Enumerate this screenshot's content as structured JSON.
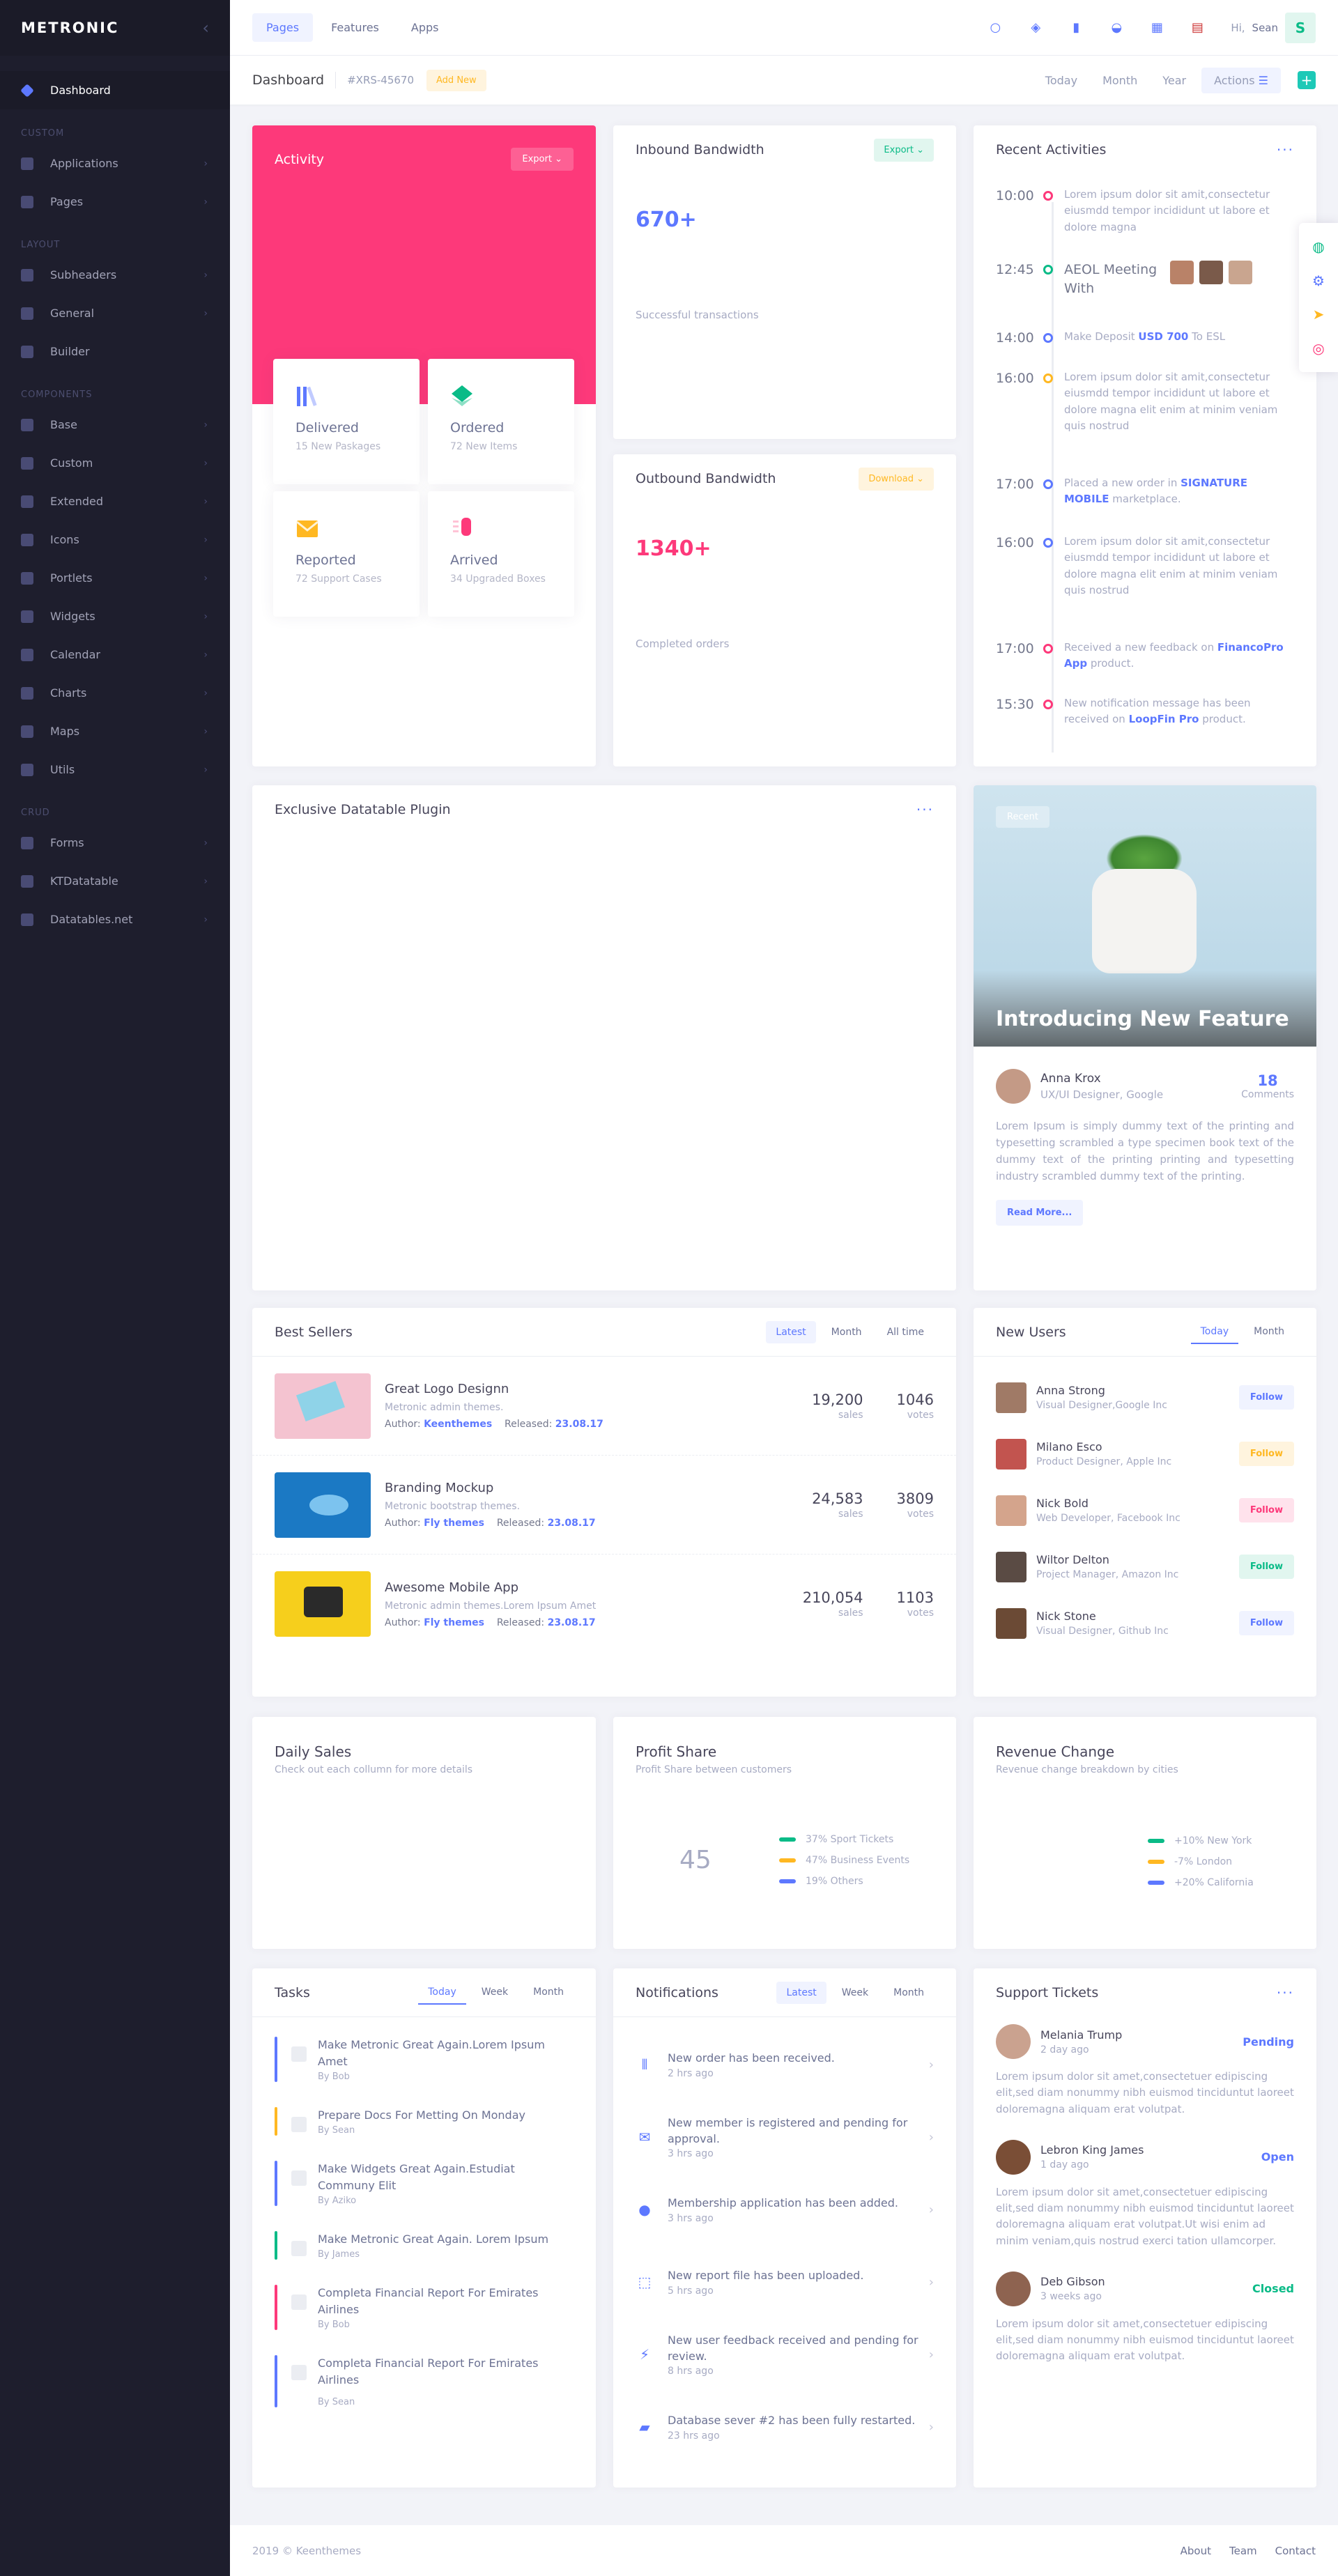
{
  "app": {
    "logo": "METRONIC",
    "collapse_icon": "chevron-left-icon"
  },
  "sidebar": {
    "dashboard": "Dashboard",
    "sections": {
      "custom": "CUSTOM",
      "layout": "LAYOUT",
      "components": "COMPONENTS",
      "crud": "CRUD"
    },
    "custom_items": [
      "Applications",
      "Pages"
    ],
    "layout_items": [
      "Subheaders",
      "General",
      "Builder"
    ],
    "component_items": [
      "Base",
      "Custom",
      "Extended",
      "Icons",
      "Portlets",
      "Widgets",
      "Calendar",
      "Charts",
      "Maps",
      "Utils"
    ],
    "crud_items": [
      "Forms",
      "KTDatatable",
      "Datatables.net"
    ]
  },
  "header": {
    "nav": [
      "Pages",
      "Features",
      "Apps"
    ],
    "greeting": "Hi,",
    "user_name": "Sean",
    "avatar_letter": "S"
  },
  "subheader": {
    "title": "Dashboard",
    "desc": "#XRS-45670",
    "add_new": "Add New",
    "ranges": [
      "Today",
      "Month",
      "Year"
    ],
    "actions": "Actions",
    "plus": "+"
  },
  "activity": {
    "title": "Activity",
    "export": "Export",
    "stats": [
      {
        "title": "Delivered",
        "sub": "15 New Paskages"
      },
      {
        "title": "Ordered",
        "sub": "72 New Items"
      },
      {
        "title": "Reported",
        "sub": "72 Support Cases"
      },
      {
        "title": "Arrived",
        "sub": "34 Upgraded Boxes"
      }
    ]
  },
  "inbound": {
    "title": "Inbound Bandwidth",
    "button": "Export",
    "value": "670+",
    "desc": "Successful transactions"
  },
  "outbound": {
    "title": "Outbound Bandwidth",
    "button": "Download",
    "value": "1340+",
    "desc": "Completed orders"
  },
  "recent_activities": {
    "title": "Recent Activities",
    "items": [
      {
        "time": "10:00",
        "text": "Lorem ipsum dolor sit amit,consectetur eiusmdd tempor incididunt ut labore et dolore magna",
        "color": "#fd397a"
      },
      {
        "time": "12:45",
        "text": "AEOL Meeting With",
        "color": "#0abb87"
      },
      {
        "time": "14:00",
        "pre": "Make Deposit",
        "link": "USD 700",
        "post": "To ESL",
        "color": "#5d78ff"
      },
      {
        "time": "16:00",
        "text": "Lorem ipsum dolor sit amit,consectetur eiusmdd tempor incididunt ut labore et dolore magna elit enim at minim veniam quis nostrud",
        "color": "#ffb822"
      },
      {
        "time": "17:00",
        "pre": "Placed a new order in",
        "link": "SIGNATURE MOBILE",
        "post": "marketplace.",
        "color": "#5d78ff"
      },
      {
        "time": "16:00",
        "text": "Lorem ipsum dolor sit amit,consectetur eiusmdd tempor incididunt ut labore et dolore magna elit enim at minim veniam quis nostrud",
        "color": "#5d78ff"
      },
      {
        "time": "17:00",
        "pre": "Received a new feedback on",
        "link": "FinancoPro App",
        "post": "product.",
        "color": "#fd397a"
      },
      {
        "time": "15:30",
        "pre": "New notification message has been received on",
        "link": "LoopFin Pro",
        "post": "product.",
        "color": "#fd397a"
      }
    ]
  },
  "datatable": {
    "title": "Exclusive Datatable Plugin"
  },
  "feature": {
    "badge": "Recent",
    "title": "Introducing New Feature",
    "author": "Anna Krox",
    "role": "UX/UI Designer, Google",
    "comments_count": "18",
    "comments_label": "Comments",
    "text": "Lorem Ipsum is simply dummy text of the printing and typesetting scrambled a type specimen book text of the dummy text of the printing printing and typesetting industry scrambled dummy text of the printing.",
    "read_more": "Read More..."
  },
  "best_sellers": {
    "title": "Best Sellers",
    "tabs": [
      "Latest",
      "Month",
      "All time"
    ],
    "items": [
      {
        "title": "Great Logo Designn",
        "desc": "Metronic admin themes.",
        "author_label": "Author:",
        "author": "Keenthemes",
        "released_label": "Released:",
        "released": "23.08.17",
        "sales": "19,200",
        "sales_label": "sales",
        "votes": "1046",
        "votes_label": "votes"
      },
      {
        "title": "Branding Mockup",
        "desc": "Metronic bootstrap themes.",
        "author_label": "Author:",
        "author": "Fly themes",
        "released_label": "Released:",
        "released": "23.08.17",
        "sales": "24,583",
        "sales_label": "sales",
        "votes": "3809",
        "votes_label": "votes"
      },
      {
        "title": "Awesome Mobile App",
        "desc": "Metronic admin themes.Lorem Ipsum Amet",
        "author_label": "Author:",
        "author": "Fly themes",
        "released_label": "Released:",
        "released": "23.08.17",
        "sales": "210,054",
        "sales_label": "sales",
        "votes": "1103",
        "votes_label": "votes"
      }
    ]
  },
  "new_users": {
    "title": "New Users",
    "tabs": [
      "Today",
      "Month"
    ],
    "items": [
      {
        "name": "Anna Strong",
        "role": "Visual Designer,Google Inc",
        "action": "Follow",
        "bg": "#f0f3ff",
        "fg": "#5d78ff"
      },
      {
        "name": "Milano Esco",
        "role": "Product Designer, Apple Inc",
        "action": "Follow",
        "bg": "#fff4de",
        "fg": "#ffb822"
      },
      {
        "name": "Nick Bold",
        "role": "Web Developer, Facebook Inc",
        "action": "Follow",
        "bg": "#ffe2ec",
        "fg": "#fd397a"
      },
      {
        "name": "Wiltor Delton",
        "role": "Project Manager, Amazon Inc",
        "action": "Follow",
        "bg": "#e1f6ef",
        "fg": "#0abb87"
      },
      {
        "name": "Nick Stone",
        "role": "Visual Designer, Github Inc",
        "action": "Follow",
        "bg": "#f0f3ff",
        "fg": "#5d78ff"
      }
    ]
  },
  "daily_sales": {
    "title": "Daily Sales",
    "sub": "Check out each collumn for more details"
  },
  "profit_share": {
    "title": "Profit Share",
    "sub": "Profit Share between customers",
    "center": "45",
    "legend": [
      {
        "label": "37% Sport Tickets",
        "color": "#0abb87"
      },
      {
        "label": "47% Business Events",
        "color": "#ffb822"
      },
      {
        "label": "19% Others",
        "color": "#5d78ff"
      }
    ]
  },
  "revenue_change": {
    "title": "Revenue Change",
    "sub": "Revenue change breakdown by cities",
    "legend": [
      {
        "label": "+10% New York",
        "color": "#0abb87"
      },
      {
        "label": "-7% London",
        "color": "#ffb822"
      },
      {
        "label": "+20% California",
        "color": "#5d78ff"
      }
    ]
  },
  "tasks": {
    "title": "Tasks",
    "tabs": [
      "Today",
      "Week",
      "Month"
    ],
    "items": [
      {
        "title": "Make Metronic Great Again.Lorem Ipsum Amet",
        "by": "By Bob",
        "color": "#5d78ff"
      },
      {
        "title": "Prepare Docs For Metting On Monday",
        "by": "By Sean",
        "color": "#ffb822"
      },
      {
        "title": "Make Widgets Great Again.Estudiat Communy Elit",
        "by": "By Aziko",
        "color": "#5d78ff"
      },
      {
        "title": "Make Metronic Great Again. Lorem Ipsum",
        "by": "By James",
        "color": "#0abb87"
      },
      {
        "title": "Completa Financial Report For Emirates Airlines",
        "by": "By Bob",
        "color": "#fd397a"
      },
      {
        "title": "Completa Financial Report For Emirates Airlines",
        "by": "By Sean",
        "color": "#5d78ff"
      }
    ]
  },
  "notifications": {
    "title": "Notifications",
    "tabs": [
      "Latest",
      "Week",
      "Month"
    ],
    "items": [
      {
        "title": "New order has been received.",
        "time": "2 hrs ago",
        "icon": "bars-icon"
      },
      {
        "title": "New member is registered and pending for approval.",
        "time": "3 hrs ago",
        "icon": "mail-icon"
      },
      {
        "title": "Membership application has been added.",
        "time": "3 hrs ago",
        "icon": "user-icon"
      },
      {
        "title": "New report file has been uploaded.",
        "time": "5 hrs ago",
        "icon": "selection-icon"
      },
      {
        "title": "New user feedback received and pending for review.",
        "time": "8 hrs ago",
        "icon": "bolt-icon"
      },
      {
        "title": "Database sever #2 has been fully restarted.",
        "time": "23 hrs ago",
        "icon": "file-icon"
      }
    ]
  },
  "support": {
    "title": "Support Tickets",
    "items": [
      {
        "name": "Melania Trump",
        "when": "2 day ago",
        "status": "Pending",
        "color": "#5d78ff",
        "text": "Lorem ipsum dolor sit amet,consectetuer edipiscing elit,sed diam nonummy nibh euismod tinciduntut laoreet doloremagna aliquam erat volutpat."
      },
      {
        "name": "Lebron King James",
        "when": "1 day ago",
        "status": "Open",
        "color": "#5d78ff",
        "text": "Lorem ipsum dolor sit amet,consectetuer edipiscing elit,sed diam nonummy nibh euismod tinciduntut laoreet doloremagna aliquam erat volutpat.Ut wisi enim ad minim veniam,quis nostrud exerci tation ullamcorper."
      },
      {
        "name": "Deb Gibson",
        "when": "3 weeks ago",
        "status": "Closed",
        "color": "#0abb87",
        "text": "Lorem ipsum dolor sit amet,consectetuer edipiscing elit,sed diam nonummy nibh euismod tinciduntut laoreet doloremagna aliquam erat volutpat."
      }
    ]
  },
  "footer": {
    "copyright": "2019 © Keenthemes",
    "links": [
      "About",
      "Team",
      "Contact"
    ]
  }
}
